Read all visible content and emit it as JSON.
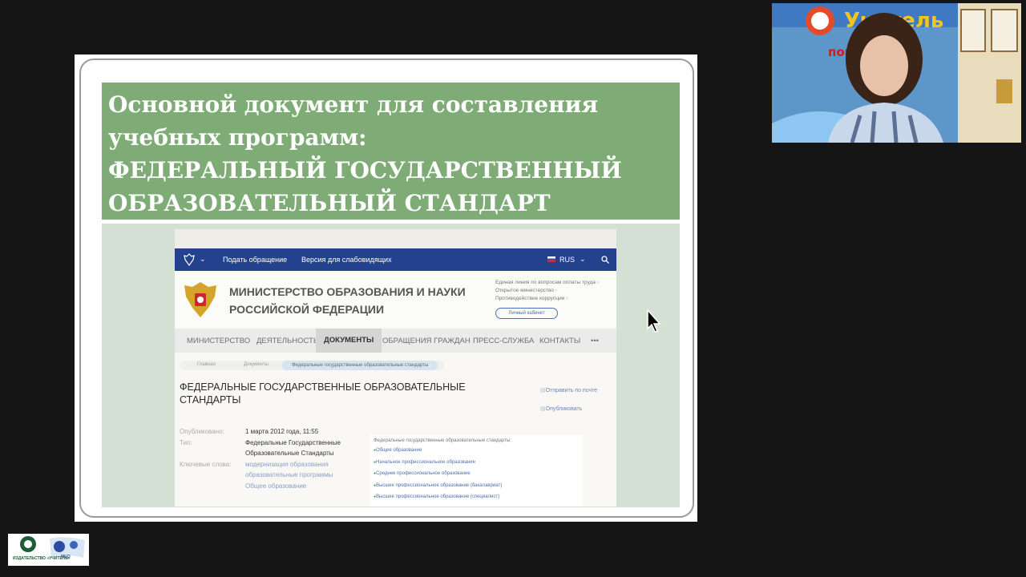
{
  "slide": {
    "title_lines": [
      "Основной документ для составления",
      "учебных программ:",
      "ФЕДЕРАЛЬНЫЙ ГОСУДАРСТВЕННЫЙ",
      "ОБРАЗОВАТЕЛЬНЫЙ СТАНДАРТ"
    ]
  },
  "site": {
    "topbar": {
      "link1": "Подать обращение",
      "link2": "Версия для слабовидящих",
      "lang": "RUS"
    },
    "ministry_lines": [
      "МИНИСТЕРСТВО ОБРАЗОВАНИЯ И НАУКИ",
      "РОССИЙСКОЙ ФЕДЕРАЦИИ"
    ],
    "quick_links": [
      "Единая линия по вопросам оплаты труда",
      "Открытое министерство",
      "Противодействие коррупции"
    ],
    "cabinet": "Личный кабинет",
    "nav": [
      "МИНИСТЕРСТВО",
      "ДЕЯТЕЛЬНОСТЬ",
      "ДОКУМЕНТЫ",
      "ОБРАЩЕНИЯ ГРАЖДАН",
      "ПРЕСС-СЛУЖБА",
      "КОНТАКТЫ",
      "•••"
    ],
    "breadcrumbs": [
      "Главная",
      "Документы",
      "Федеральные государственные образовательные стандарты"
    ],
    "page_title": "ФЕДЕРАЛЬНЫЕ ГОСУДАРСТВЕННЫЕ ОБРАЗОВАТЕЛЬНЫЕ СТАНДАРТЫ",
    "side_links": [
      "Отправить по почте",
      "Опубликовать"
    ],
    "meta": {
      "published_label": "Опубликовано:",
      "published_value": "1 марта 2012 года, 11:55",
      "type_label": "Тип:",
      "type_value_1": "Федеральные Государственные",
      "type_value_2": "Образовательные Стандарты",
      "keywords_label": "Ключевые слова:",
      "kw1": "модернизация образования",
      "kw2": "образовательные программы",
      "kw3": "Общее образование"
    },
    "list_heading": "Федеральные государственные образовательные стандарты:",
    "list_items": [
      "Общее образование",
      "Начальное профессиональное образование",
      "Среднее профессиональное образование",
      "Высшее профессиональное образование (бакалавриат)",
      "Высшее профессиональное образование (специалист)"
    ]
  },
  "webcam": {
    "banner_text": "Учитель",
    "check_text": "повы"
  },
  "corner_logo": {
    "publisher": "ИЗДАТЕЛЬСТВО «УЧИТЕЛЬ»",
    "org": "МЦО"
  },
  "colors": {
    "title_bg": "#7fac76",
    "site_topbar": "#24418e",
    "background": "#151515"
  }
}
